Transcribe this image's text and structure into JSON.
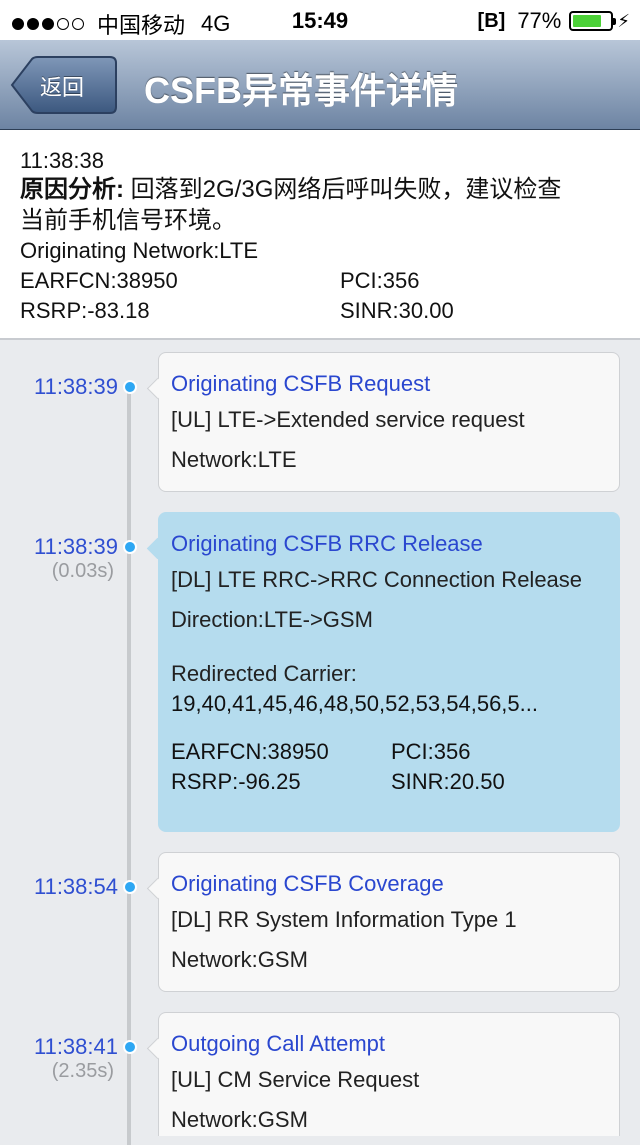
{
  "status_bar": {
    "carrier": "中国移动",
    "network": "4G",
    "time": "15:49",
    "bt_label": "[B]",
    "battery": "77%",
    "battery_level": 0.77,
    "battery_color": "#4cd137"
  },
  "nav": {
    "back_label": "返回",
    "title": "CSFB异常事件详情"
  },
  "summary": {
    "time": "11:38:38",
    "cause_label": "原因分析:",
    "cause_text": " 回落到2G/3G网络后呼叫失败，建议检查",
    "cause_text_2": "当前手机信号环境。",
    "originating_network": "Originating Network:LTE",
    "earfcn": "EARFCN:38950",
    "pci": "PCI:356",
    "rsrp": "RSRP:-83.18",
    "sinr": "SINR:30.00"
  },
  "events": [
    {
      "time": "11:38:39",
      "delta": "",
      "title": "Originating CSFB Request",
      "line1": "[UL] LTE->Extended service request",
      "line2": "Network:LTE"
    },
    {
      "time": "11:38:39",
      "delta": "(0.03s)",
      "title": "Originating CSFB RRC Release",
      "line1": "[DL] LTE RRC->RRC Connection Release",
      "line2": "Direction:LTE->GSM",
      "redirected_label": "Redirected Carrier:",
      "redirected_values": "19,40,41,45,46,48,50,52,53,54,56,5...",
      "earfcn": "EARFCN:38950",
      "pci": "PCI:356",
      "rsrp": "RSRP:-96.25",
      "sinr": "SINR:20.50"
    },
    {
      "time": "11:38:54",
      "delta": "",
      "title": "Originating CSFB Coverage",
      "line1": "[DL] RR System Information Type 1",
      "line2": "Network:GSM"
    },
    {
      "time": "11:38:41",
      "delta": "(2.35s)",
      "title": "Outgoing Call Attempt",
      "line1": "[UL] CM Service Request",
      "line2": "Network:GSM"
    }
  ],
  "colors": {
    "accent_blue": "#2a47cf",
    "timeline_dot": "#2ea7f3",
    "highlight_card": "#b5dcee",
    "nav_gradient_top": "#b8c6d8",
    "nav_gradient_bottom": "#6d84a3"
  }
}
